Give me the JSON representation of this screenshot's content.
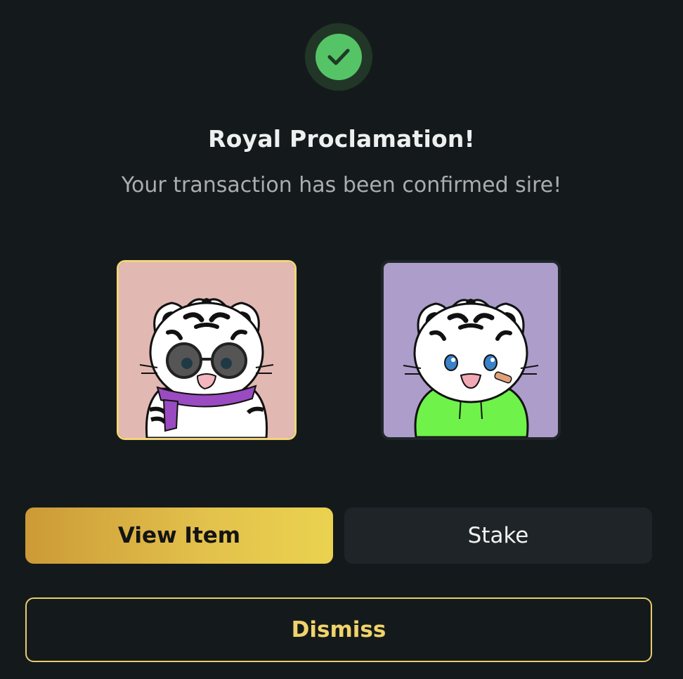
{
  "status": {
    "icon": "check-icon",
    "ring_color": "#223627",
    "dot_color": "#55c466"
  },
  "title": "Royal Proclamation!",
  "subtitle": "Your transaction has been confirmed sire!",
  "items": [
    {
      "name": "tiger-nft-sunglasses-scarf",
      "selected": true,
      "background": "#e2b8b3",
      "accessory": "purple-scarf-and-round-sunglasses"
    },
    {
      "name": "tiger-nft-green-hoodie",
      "selected": false,
      "background": "#ac9dcb",
      "accessory": "green-hoodie-and-bandage"
    }
  ],
  "actions": {
    "view_item_label": "View Item",
    "stake_label": "Stake",
    "dismiss_label": "Dismiss"
  },
  "colors": {
    "background": "#141a1c",
    "accent_gold": "#e3c24c",
    "dismiss_text": "#f0d36a"
  }
}
